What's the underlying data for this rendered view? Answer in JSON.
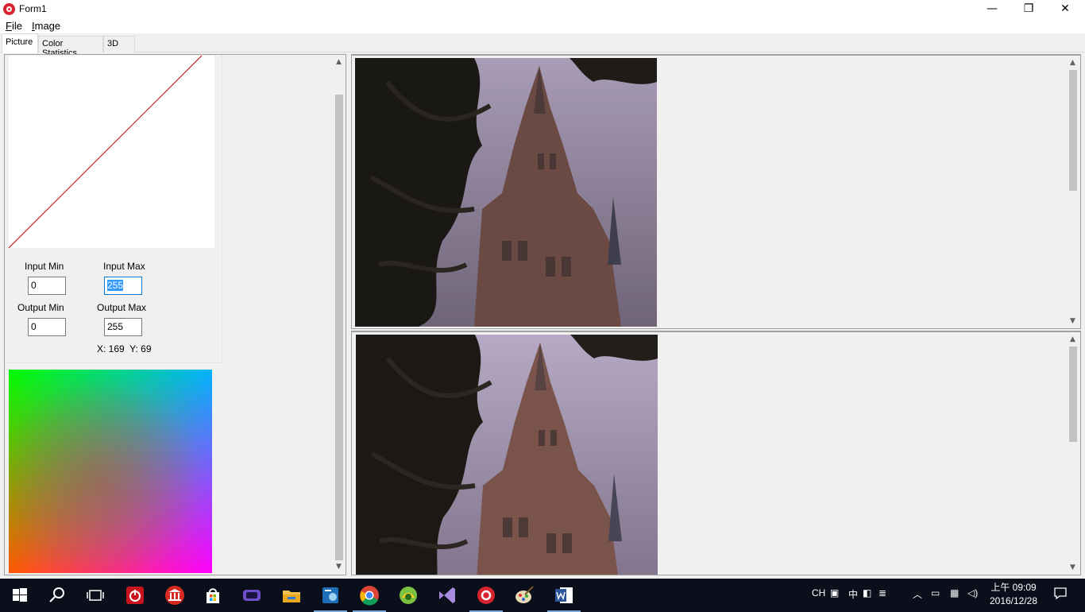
{
  "window": {
    "title": "Form1"
  },
  "window_controls": {
    "minimize": "—",
    "restore": "❐",
    "close": "✕"
  },
  "menu": [
    {
      "label": "File",
      "mnemonic": "F",
      "rest": "ile"
    },
    {
      "label": "Image",
      "mnemonic": "I",
      "rest": "mage"
    }
  ],
  "tabs": [
    {
      "label": "Picture",
      "active": true
    },
    {
      "label": "Color Statistics",
      "active": false
    },
    {
      "label": "3D",
      "active": false
    }
  ],
  "levels": {
    "input_min_label": "Input Min",
    "input_max_label": "Input Max",
    "output_min_label": "Output Min",
    "output_max_label": "Output Max",
    "input_min": "0",
    "input_max": "255",
    "output_min": "0",
    "output_max": "255",
    "coords": "X: 169  Y: 69"
  },
  "colors": {
    "curve_line": "#c00000",
    "accent": "#0078d7",
    "taskbar": "#0b0f1c"
  },
  "taskbar": {
    "icons": [
      "start-icon",
      "search-icon",
      "task-view-icon",
      "power-app-icon",
      "bank-app-icon",
      "store-icon",
      "game-app-icon",
      "file-explorer-icon",
      "app-settings-icon",
      "chrome-icon",
      "camera-app-icon",
      "visual-studio-icon",
      "form1-app-icon",
      "paint-app-icon",
      "word-icon"
    ],
    "tray": {
      "lang": "CH",
      "ime": "中",
      "time": "上午 09:09",
      "date": "2016/12/28"
    }
  }
}
